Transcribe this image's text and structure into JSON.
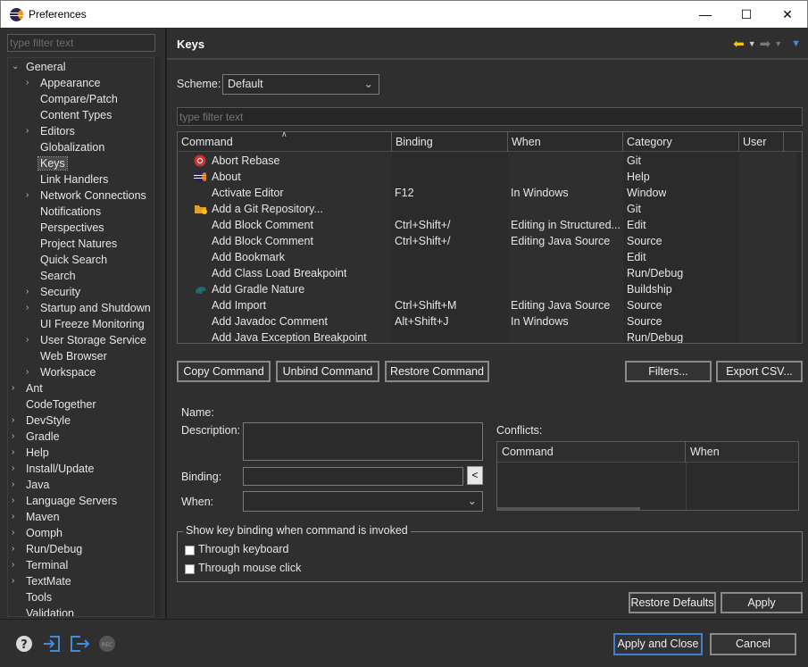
{
  "window": {
    "title": "Preferences",
    "minimize": "—",
    "maximize": "☐",
    "close": "✕"
  },
  "left": {
    "filter_placeholder": "type filter text",
    "tree": [
      {
        "label": "General",
        "level": 0,
        "arrow": "⌄"
      },
      {
        "label": "Appearance",
        "level": 1,
        "arrow": "›"
      },
      {
        "label": "Compare/Patch",
        "level": 1,
        "arrow": ""
      },
      {
        "label": "Content Types",
        "level": 1,
        "arrow": ""
      },
      {
        "label": "Editors",
        "level": 1,
        "arrow": "›"
      },
      {
        "label": "Globalization",
        "level": 1,
        "arrow": ""
      },
      {
        "label": "Keys",
        "level": 1,
        "arrow": "",
        "selected": true
      },
      {
        "label": "Link Handlers",
        "level": 1,
        "arrow": ""
      },
      {
        "label": "Network Connections",
        "level": 1,
        "arrow": "›"
      },
      {
        "label": "Notifications",
        "level": 1,
        "arrow": ""
      },
      {
        "label": "Perspectives",
        "level": 1,
        "arrow": ""
      },
      {
        "label": "Project Natures",
        "level": 1,
        "arrow": ""
      },
      {
        "label": "Quick Search",
        "level": 1,
        "arrow": ""
      },
      {
        "label": "Search",
        "level": 1,
        "arrow": ""
      },
      {
        "label": "Security",
        "level": 1,
        "arrow": "›"
      },
      {
        "label": "Startup and Shutdown",
        "level": 1,
        "arrow": "›"
      },
      {
        "label": "UI Freeze Monitoring",
        "level": 1,
        "arrow": ""
      },
      {
        "label": "User Storage Service",
        "level": 1,
        "arrow": "›"
      },
      {
        "label": "Web Browser",
        "level": 1,
        "arrow": ""
      },
      {
        "label": "Workspace",
        "level": 1,
        "arrow": "›"
      },
      {
        "label": "Ant",
        "level": 0,
        "arrow": "›"
      },
      {
        "label": "CodeTogether",
        "level": 0,
        "arrow": ""
      },
      {
        "label": "DevStyle",
        "level": 0,
        "arrow": "›"
      },
      {
        "label": "Gradle",
        "level": 0,
        "arrow": "›"
      },
      {
        "label": "Help",
        "level": 0,
        "arrow": "›"
      },
      {
        "label": "Install/Update",
        "level": 0,
        "arrow": "›"
      },
      {
        "label": "Java",
        "level": 0,
        "arrow": "›"
      },
      {
        "label": "Language Servers",
        "level": 0,
        "arrow": "›"
      },
      {
        "label": "Maven",
        "level": 0,
        "arrow": "›"
      },
      {
        "label": "Oomph",
        "level": 0,
        "arrow": "›"
      },
      {
        "label": "Run/Debug",
        "level": 0,
        "arrow": "›"
      },
      {
        "label": "Terminal",
        "level": 0,
        "arrow": "›"
      },
      {
        "label": "TextMate",
        "level": 0,
        "arrow": "›"
      },
      {
        "label": "Tools",
        "level": 0,
        "arrow": ""
      },
      {
        "label": "Validation",
        "level": 0,
        "arrow": ""
      }
    ]
  },
  "page": {
    "title": "Keys",
    "scheme_label": "Scheme:",
    "scheme_value": "Default",
    "filter_placeholder": "type filter text",
    "columns": [
      "Command",
      "Binding",
      "When",
      "Category",
      "User"
    ],
    "rows": [
      {
        "command": "Abort Rebase",
        "binding": "",
        "when": "",
        "category": "Git",
        "icon": "abort-rebase-icon"
      },
      {
        "command": "About",
        "binding": "",
        "when": "",
        "category": "Help",
        "icon": "eclipse-about-icon"
      },
      {
        "command": "Activate Editor",
        "binding": "F12",
        "when": "In Windows",
        "category": "Window",
        "icon": ""
      },
      {
        "command": "Add a Git Repository...",
        "binding": "",
        "when": "",
        "category": "Git",
        "icon": "git-repository-icon"
      },
      {
        "command": "Add Block Comment",
        "binding": "Ctrl+Shift+/",
        "when": "Editing in Structured...",
        "category": "Edit",
        "icon": ""
      },
      {
        "command": "Add Block Comment",
        "binding": "Ctrl+Shift+/",
        "when": "Editing Java Source",
        "category": "Source",
        "icon": ""
      },
      {
        "command": "Add Bookmark",
        "binding": "",
        "when": "",
        "category": "Edit",
        "icon": ""
      },
      {
        "command": "Add Class Load Breakpoint",
        "binding": "",
        "when": "",
        "category": "Run/Debug",
        "icon": ""
      },
      {
        "command": "Add Gradle Nature",
        "binding": "",
        "when": "",
        "category": "Buildship",
        "icon": "gradle-icon"
      },
      {
        "command": "Add Import",
        "binding": "Ctrl+Shift+M",
        "when": "Editing Java Source",
        "category": "Source",
        "icon": ""
      },
      {
        "command": "Add Javadoc Comment",
        "binding": "Alt+Shift+J",
        "when": "In Windows",
        "category": "Source",
        "icon": ""
      },
      {
        "command": "Add Java Exception Breakpoint",
        "binding": "",
        "when": "",
        "category": "Run/Debug",
        "icon": ""
      }
    ],
    "buttons": {
      "copy": "Copy Command",
      "unbind": "Unbind Command",
      "restore": "Restore Command",
      "filters": "Filters...",
      "export": "Export CSV..."
    },
    "name_label": "Name:",
    "description_label": "Description:",
    "binding_label": "Binding:",
    "when_label": "When:",
    "binding_btn": "<",
    "conflicts_label": "Conflicts:",
    "conflict_columns": [
      "Command",
      "When"
    ],
    "group_title": "Show key binding when command is invoked",
    "through_keyboard": "Through keyboard",
    "through_mouse": "Through mouse click",
    "restore_defaults": "Restore Defaults",
    "apply": "Apply"
  },
  "bottom": {
    "apply_close": "Apply and Close",
    "cancel": "Cancel"
  },
  "colors": {
    "background": "#2f2f2f",
    "accent_blue": "#3f7fd1",
    "back_arrow": "#f0c419"
  }
}
